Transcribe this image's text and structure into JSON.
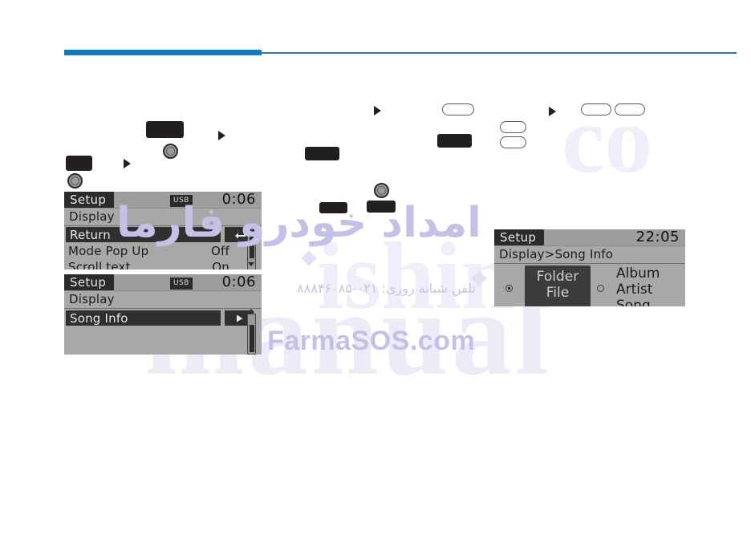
{
  "page": {
    "background_color": "#ffffff",
    "accent_color": "#1579bf",
    "rule_color": "#2a7ca3"
  },
  "steps": {
    "arrow_glyph": "▶",
    "knob_name": "rotary-knob",
    "buttons": [
      {
        "id": "btn-1",
        "label": "",
        "style": "dark"
      },
      {
        "id": "btn-2",
        "label": "",
        "style": "dark"
      },
      {
        "id": "btn-3",
        "label": "",
        "style": "dark"
      },
      {
        "id": "btn-4",
        "label": "",
        "style": "dark"
      },
      {
        "id": "btn-5",
        "label": "",
        "style": "dark"
      },
      {
        "id": "btn-6",
        "label": "",
        "style": "dark"
      },
      {
        "id": "btn-7",
        "label": "",
        "style": "dark"
      },
      {
        "id": "btn-8",
        "label": "",
        "style": "hollow"
      },
      {
        "id": "btn-9",
        "label": "",
        "style": "hollow"
      },
      {
        "id": "btn-10",
        "label": "",
        "style": "hollow"
      },
      {
        "id": "btn-11",
        "label": "",
        "style": "hollow"
      }
    ]
  },
  "display_1": {
    "title": "Setup",
    "usb_badge": "USB",
    "clock": "0:06",
    "breadcrumb": "Display",
    "rows": [
      {
        "label": "Return",
        "value": "",
        "selected": true,
        "icon": "return-arrow-icon"
      },
      {
        "label": "Mode Pop Up",
        "value": "Off",
        "selected": false,
        "icon": ""
      },
      {
        "label": "Scroll text",
        "value": "On",
        "selected": false,
        "icon": ""
      }
    ],
    "scroll": {
      "position": "top"
    }
  },
  "display_2": {
    "title": "Setup",
    "usb_badge": "USB",
    "clock": "0:06",
    "breadcrumb": "Display",
    "rows": [
      {
        "label": "Song Info",
        "value": "",
        "selected": true,
        "icon": "next-arrow-icon"
      }
    ],
    "scroll": {
      "position": "bottom"
    }
  },
  "display_3": {
    "title": "Setup",
    "clock": "22:05",
    "breadcrumb": "Display>Song Info",
    "option_selected": {
      "label_line_1": "Folder",
      "label_line_2": "File",
      "state": "selected"
    },
    "option_unselected": {
      "lines": [
        "Album",
        "Artist",
        "Song"
      ],
      "state": "unselected"
    }
  },
  "watermarks": {
    "brand_fa": "امداد خودرو فارما",
    "phone_fa": "تلفن شبانه روزی: ۰۲۱-۸۸۸۴۶۰۸۵",
    "site": "FarmaSOS.com",
    "ghost_left": "manual",
    "ghost_mid": "ishine",
    "ghost_right": "co"
  }
}
